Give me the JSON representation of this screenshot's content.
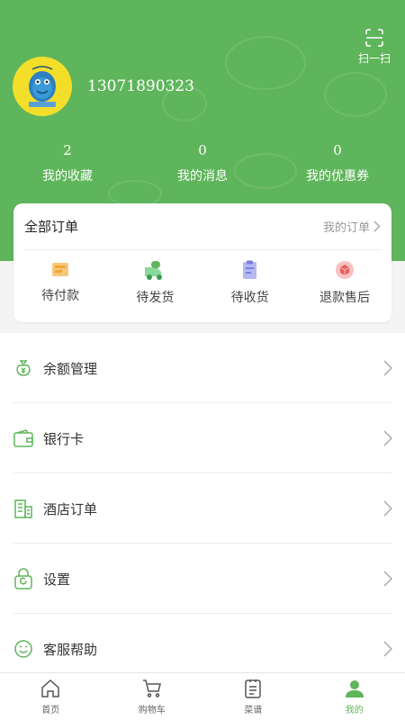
{
  "header": {
    "scan_label": "扫一扫",
    "user": {
      "phone": "13071890323"
    },
    "stats": [
      {
        "count": "2",
        "label": "我的收藏"
      },
      {
        "count": "0",
        "label": "我的消息"
      },
      {
        "count": "0",
        "label": "我的优惠券"
      }
    ]
  },
  "orders": {
    "title": "全部订单",
    "link": "我的订单",
    "states": [
      {
        "label": "待付款",
        "icon": "wallet-icon"
      },
      {
        "label": "待发货",
        "icon": "truck-icon"
      },
      {
        "label": "待收货",
        "icon": "clipboard-icon"
      },
      {
        "label": "退款售后",
        "icon": "box-icon"
      }
    ]
  },
  "menu": {
    "items": [
      {
        "label": "余额管理",
        "icon": "money-bag-icon"
      },
      {
        "label": "银行卡",
        "icon": "wallet-card-icon"
      },
      {
        "label": "酒店订单",
        "icon": "building-icon"
      },
      {
        "label": "设置",
        "icon": "lock-settings-icon"
      },
      {
        "label": "客服帮助",
        "icon": "smile-icon"
      }
    ]
  },
  "tabbar": {
    "items": [
      {
        "label": "首页",
        "icon": "home-icon"
      },
      {
        "label": "购物车",
        "icon": "cart-icon"
      },
      {
        "label": "菜谱",
        "icon": "recipe-icon"
      },
      {
        "label": "我的",
        "icon": "person-icon",
        "active": true
      }
    ]
  },
  "colors": {
    "brand_green": "#5fb55b",
    "accent_orange": "#f0a73a",
    "accent_purple": "#7d7fdc",
    "accent_red": "#e55f5f"
  }
}
